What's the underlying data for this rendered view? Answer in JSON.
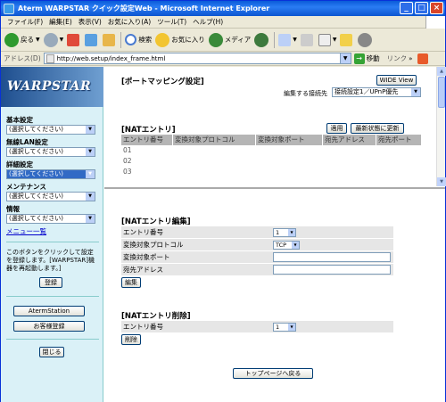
{
  "window": {
    "title": "Aterm WARPSTAR クイック設定Web - Microsoft Internet Explorer"
  },
  "menu": [
    "ファイル(F)",
    "編集(E)",
    "表示(V)",
    "お気に入り(A)",
    "ツール(T)",
    "ヘルプ(H)"
  ],
  "toolbar": {
    "back": "戻る",
    "search": "検索",
    "favorites": "お気に入り",
    "media": "メディア"
  },
  "address": {
    "label": "アドレス(D)",
    "url": "http://web.setup/index_frame.html",
    "go": "移動",
    "links": "リンク"
  },
  "sidebar": {
    "logo": "WARPSTAR",
    "groups": [
      {
        "heading": "基本設定",
        "value": "(選択してください)"
      },
      {
        "heading": "無線LAN設定",
        "value": "(選択してください)"
      },
      {
        "heading": "詳細設定",
        "value": "(選択してください)"
      },
      {
        "heading": "メンテナンス",
        "value": "(選択してください)"
      },
      {
        "heading": "情報",
        "value": "(選択してください)"
      }
    ],
    "menu_link": "メニュー一覧",
    "register_note": "このボタンをクリックして設定を登録します。[WARPSTAR]機器を再起動します。]",
    "register_button": "登録",
    "aterm_station": "AtermStation",
    "customer_register": "お客様登録",
    "close_button": "閉じる"
  },
  "main": {
    "title": "[ポートマッピング設定]",
    "wide_view": "WIDE View",
    "connection_label": "編集する接続先",
    "connection_value": "接続設定1／UPnP優先",
    "nat_title": "[NATエントリ]",
    "apply": "適用",
    "refresh": "最新状態に更新",
    "headers": [
      "エントリ番号",
      "変換対象プロトコル",
      "変換対象ポート",
      "宛先アドレス",
      "宛先ポート"
    ],
    "rows": [
      "01",
      "02",
      "03"
    ]
  },
  "edit": {
    "title": "[NATエントリ編集]",
    "entry_label": "エントリ番号",
    "entry_value": "1",
    "protocol_label": "変換対象プロトコル",
    "protocol_value": "TCP",
    "port_label": "変換対象ポート",
    "dest_label": "宛先アドレス",
    "edit_button": "編集"
  },
  "delete": {
    "title": "[NATエントリ削除]",
    "entry_label": "エントリ番号",
    "entry_value": "1",
    "delete_button": "削除"
  },
  "top_button": "トップページへ戻る"
}
